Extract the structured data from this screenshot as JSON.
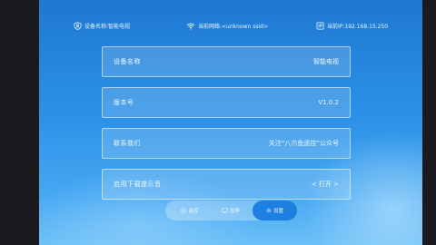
{
  "status_bar": {
    "device_name": "设备名称:智能电视",
    "network": "当前网络:<unknown ssid>",
    "ip": "当前IP:192.168.15.250"
  },
  "settings": {
    "rows": [
      {
        "label": "设备名称",
        "value": "智能电视"
      },
      {
        "label": "版本号",
        "value": "V1.0.2"
      },
      {
        "label": "联系我们",
        "value": "关注“八爪鱼遥控”公众号"
      },
      {
        "label": "启用下载提示音",
        "value": "< 打开 >"
      }
    ]
  },
  "nav": {
    "tabs": [
      {
        "label": "遥控",
        "icon": "remote-icon"
      },
      {
        "label": "投屏",
        "icon": "cast-icon"
      },
      {
        "label": "设置",
        "icon": "gear-icon",
        "active": true
      }
    ]
  },
  "colors": {
    "accent": "#1d7fe0",
    "background_top": "#1f78d2",
    "background_bottom": "#6bc0f7"
  }
}
